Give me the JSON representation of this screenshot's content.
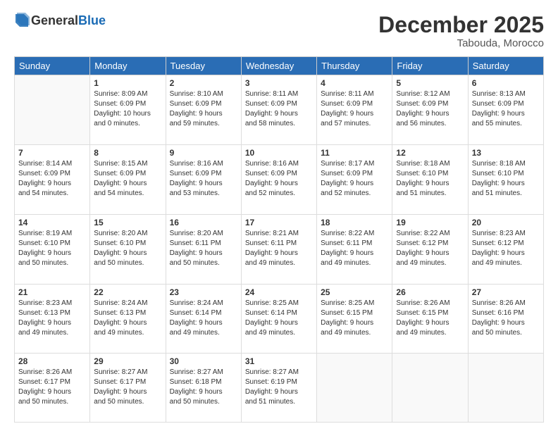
{
  "header": {
    "logo_general": "General",
    "logo_blue": "Blue",
    "month_title": "December 2025",
    "subtitle": "Tabouda, Morocco"
  },
  "weekdays": [
    "Sunday",
    "Monday",
    "Tuesday",
    "Wednesday",
    "Thursday",
    "Friday",
    "Saturday"
  ],
  "weeks": [
    [
      {
        "day": "",
        "info": ""
      },
      {
        "day": "1",
        "info": "Sunrise: 8:09 AM\nSunset: 6:09 PM\nDaylight: 10 hours\nand 0 minutes."
      },
      {
        "day": "2",
        "info": "Sunrise: 8:10 AM\nSunset: 6:09 PM\nDaylight: 9 hours\nand 59 minutes."
      },
      {
        "day": "3",
        "info": "Sunrise: 8:11 AM\nSunset: 6:09 PM\nDaylight: 9 hours\nand 58 minutes."
      },
      {
        "day": "4",
        "info": "Sunrise: 8:11 AM\nSunset: 6:09 PM\nDaylight: 9 hours\nand 57 minutes."
      },
      {
        "day": "5",
        "info": "Sunrise: 8:12 AM\nSunset: 6:09 PM\nDaylight: 9 hours\nand 56 minutes."
      },
      {
        "day": "6",
        "info": "Sunrise: 8:13 AM\nSunset: 6:09 PM\nDaylight: 9 hours\nand 55 minutes."
      }
    ],
    [
      {
        "day": "7",
        "info": "Sunrise: 8:14 AM\nSunset: 6:09 PM\nDaylight: 9 hours\nand 54 minutes."
      },
      {
        "day": "8",
        "info": "Sunrise: 8:15 AM\nSunset: 6:09 PM\nDaylight: 9 hours\nand 54 minutes."
      },
      {
        "day": "9",
        "info": "Sunrise: 8:16 AM\nSunset: 6:09 PM\nDaylight: 9 hours\nand 53 minutes."
      },
      {
        "day": "10",
        "info": "Sunrise: 8:16 AM\nSunset: 6:09 PM\nDaylight: 9 hours\nand 52 minutes."
      },
      {
        "day": "11",
        "info": "Sunrise: 8:17 AM\nSunset: 6:09 PM\nDaylight: 9 hours\nand 52 minutes."
      },
      {
        "day": "12",
        "info": "Sunrise: 8:18 AM\nSunset: 6:10 PM\nDaylight: 9 hours\nand 51 minutes."
      },
      {
        "day": "13",
        "info": "Sunrise: 8:18 AM\nSunset: 6:10 PM\nDaylight: 9 hours\nand 51 minutes."
      }
    ],
    [
      {
        "day": "14",
        "info": "Sunrise: 8:19 AM\nSunset: 6:10 PM\nDaylight: 9 hours\nand 50 minutes."
      },
      {
        "day": "15",
        "info": "Sunrise: 8:20 AM\nSunset: 6:10 PM\nDaylight: 9 hours\nand 50 minutes."
      },
      {
        "day": "16",
        "info": "Sunrise: 8:20 AM\nSunset: 6:11 PM\nDaylight: 9 hours\nand 50 minutes."
      },
      {
        "day": "17",
        "info": "Sunrise: 8:21 AM\nSunset: 6:11 PM\nDaylight: 9 hours\nand 49 minutes."
      },
      {
        "day": "18",
        "info": "Sunrise: 8:22 AM\nSunset: 6:11 PM\nDaylight: 9 hours\nand 49 minutes."
      },
      {
        "day": "19",
        "info": "Sunrise: 8:22 AM\nSunset: 6:12 PM\nDaylight: 9 hours\nand 49 minutes."
      },
      {
        "day": "20",
        "info": "Sunrise: 8:23 AM\nSunset: 6:12 PM\nDaylight: 9 hours\nand 49 minutes."
      }
    ],
    [
      {
        "day": "21",
        "info": "Sunrise: 8:23 AM\nSunset: 6:13 PM\nDaylight: 9 hours\nand 49 minutes."
      },
      {
        "day": "22",
        "info": "Sunrise: 8:24 AM\nSunset: 6:13 PM\nDaylight: 9 hours\nand 49 minutes."
      },
      {
        "day": "23",
        "info": "Sunrise: 8:24 AM\nSunset: 6:14 PM\nDaylight: 9 hours\nand 49 minutes."
      },
      {
        "day": "24",
        "info": "Sunrise: 8:25 AM\nSunset: 6:14 PM\nDaylight: 9 hours\nand 49 minutes."
      },
      {
        "day": "25",
        "info": "Sunrise: 8:25 AM\nSunset: 6:15 PM\nDaylight: 9 hours\nand 49 minutes."
      },
      {
        "day": "26",
        "info": "Sunrise: 8:26 AM\nSunset: 6:15 PM\nDaylight: 9 hours\nand 49 minutes."
      },
      {
        "day": "27",
        "info": "Sunrise: 8:26 AM\nSunset: 6:16 PM\nDaylight: 9 hours\nand 50 minutes."
      }
    ],
    [
      {
        "day": "28",
        "info": "Sunrise: 8:26 AM\nSunset: 6:17 PM\nDaylight: 9 hours\nand 50 minutes."
      },
      {
        "day": "29",
        "info": "Sunrise: 8:27 AM\nSunset: 6:17 PM\nDaylight: 9 hours\nand 50 minutes."
      },
      {
        "day": "30",
        "info": "Sunrise: 8:27 AM\nSunset: 6:18 PM\nDaylight: 9 hours\nand 50 minutes."
      },
      {
        "day": "31",
        "info": "Sunrise: 8:27 AM\nSunset: 6:19 PM\nDaylight: 9 hours\nand 51 minutes."
      },
      {
        "day": "",
        "info": ""
      },
      {
        "day": "",
        "info": ""
      },
      {
        "day": "",
        "info": ""
      }
    ]
  ]
}
